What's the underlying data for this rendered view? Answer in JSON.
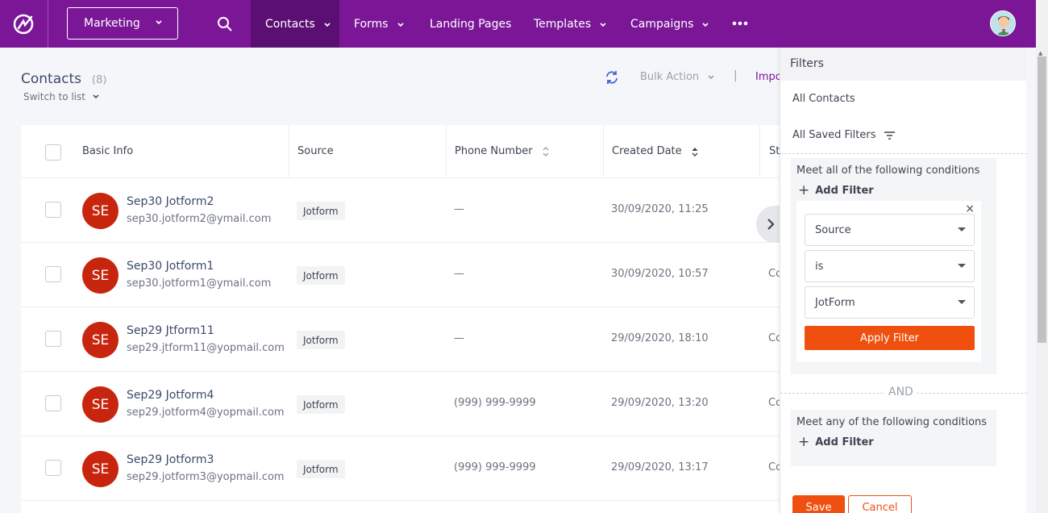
{
  "nav": {
    "workspace": "Marketing",
    "items": [
      {
        "label": "Contacts",
        "dropdown": true,
        "active": true
      },
      {
        "label": "Forms",
        "dropdown": true
      },
      {
        "label": "Landing Pages",
        "dropdown": false
      },
      {
        "label": "Templates",
        "dropdown": true
      },
      {
        "label": "Campaigns",
        "dropdown": true
      }
    ],
    "accent": "#7b1797"
  },
  "header": {
    "title": "Contacts",
    "count": "(8)",
    "switch_list": "Switch to list",
    "bulk_action": "Bulk Action",
    "separator": "|",
    "import": "Impo"
  },
  "table": {
    "columns": [
      "Basic Info",
      "Source",
      "Phone Number",
      "Created Date",
      "St"
    ],
    "rows": [
      {
        "initials": "SE",
        "name": "Sep30 Jotform2",
        "email": "sep30.jotform2@ymail.com",
        "source": "Jotform",
        "phone": "—",
        "created": "30/09/2020, 11:25",
        "status": ""
      },
      {
        "initials": "SE",
        "name": "Sep30 Jotform1",
        "email": "sep30.jotform1@ymail.com",
        "source": "Jotform",
        "phone": "—",
        "created": "30/09/2020, 10:57",
        "status": "Co"
      },
      {
        "initials": "SE",
        "name": "Sep29 Jtform11",
        "email": "sep29.jtform11@yopmail.com",
        "source": "Jotform",
        "phone": "—",
        "created": "29/09/2020, 18:10",
        "status": "Co"
      },
      {
        "initials": "SE",
        "name": "Sep29 Jotform4",
        "email": "sep29.jotform4@yopmail.com",
        "source": "Jotform",
        "phone": "(999) 999-9999",
        "created": "29/09/2020, 13:20",
        "status": "Co"
      },
      {
        "initials": "SE",
        "name": "Sep29 Jotform3",
        "email": "sep29.jotform3@yopmail.com",
        "source": "Jotform",
        "phone": "(999) 999-9999",
        "created": "29/09/2020, 13:17",
        "status": "Co"
      }
    ]
  },
  "filters": {
    "title": "Filters",
    "all_contacts": "All Contacts",
    "all_saved": "All Saved Filters",
    "meet_all": "Meet all of the following conditions",
    "add_filter": "Add Filter",
    "rule": {
      "field": "Source",
      "operator": "is",
      "value": "JotForm",
      "close": "×"
    },
    "apply": "Apply Filter",
    "and": "AND",
    "meet_any": "Meet any of the following conditions",
    "save": "Save",
    "cancel": "Cancel",
    "action_color": "#f0500f"
  }
}
